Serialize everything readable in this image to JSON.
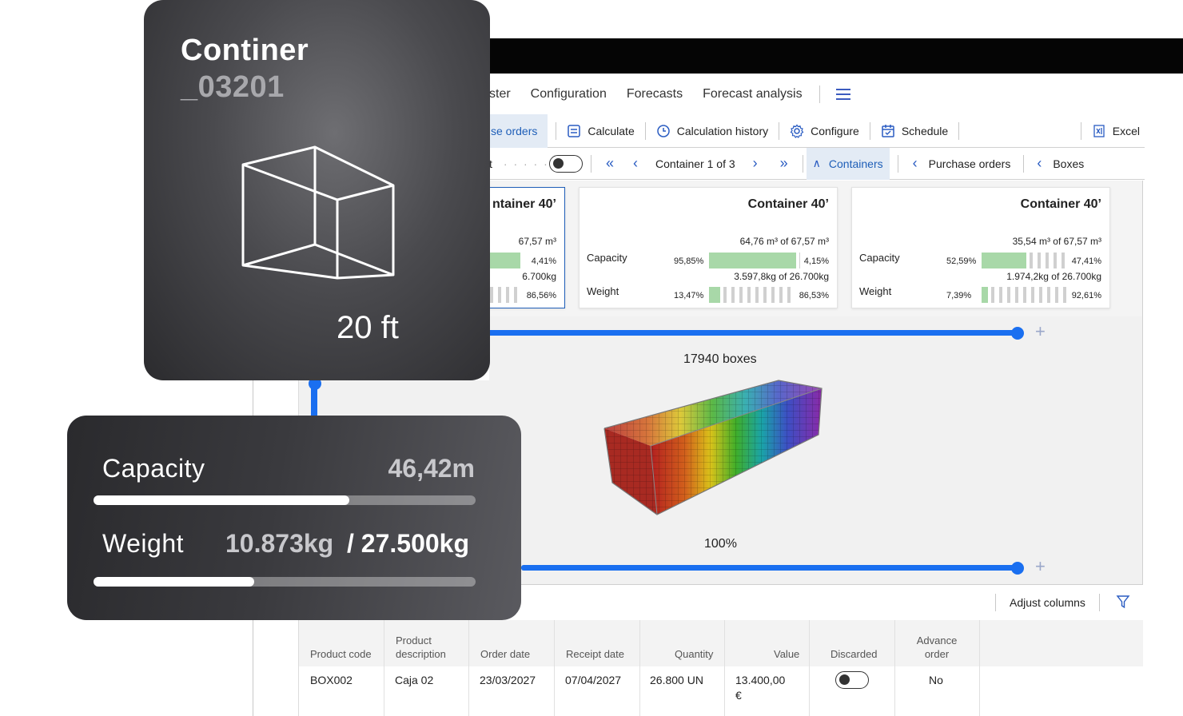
{
  "container_card": {
    "title": "Continer",
    "code": "_03201",
    "size": "20 ft"
  },
  "stats_card": {
    "capacity_label": "Capacity",
    "capacity_value": "46,42m",
    "capacity_fill": 0.67,
    "weight_label": "Weight",
    "weight_used": "10.873kg",
    "weight_total": "/ 27.500kg",
    "weight_fill": 0.42
  },
  "menu": {
    "items": [
      "ster",
      "Configuration",
      "Forecasts",
      "Forecast analysis"
    ]
  },
  "toolbar": {
    "purchase_orders": "se orders",
    "calculate": "Calculate",
    "calculation_history": "Calculation history",
    "configure": "Configure",
    "schedule": "Schedule",
    "excel": "Excel"
  },
  "nav": {
    "left_text": "t",
    "container_counter": "Container 1 of 3",
    "containers": "Containers",
    "purchase_orders": "Purchase orders",
    "boxes": "Boxes"
  },
  "cards": [
    {
      "title": "ntainer 40’",
      "capacity_value": "67,57 m³",
      "capacity_pct_right": "4,41%",
      "weight_value": "6.700kg",
      "weight_pct_right": "86,56%"
    },
    {
      "title": "Container 40’",
      "capacity_label": "Capacity",
      "capacity_value": "64,76 m³ of 67,57 m³",
      "capacity_pct_left": "95,85%",
      "capacity_pct_right": "4,15%",
      "capacity_fill": 0.9585,
      "weight_label": "Weight",
      "weight_value": "3.597,8kg of 26.700kg",
      "weight_pct_left": "13,47%",
      "weight_pct_right": "86,53%",
      "weight_fill": 0.1347
    },
    {
      "title": "Container 40’",
      "capacity_label": "Capacity",
      "capacity_value": "35,54 m³ of 67,57 m³",
      "capacity_pct_left": "52,59%",
      "capacity_pct_right": "47,41%",
      "capacity_fill": 0.5259,
      "weight_label": "Weight",
      "weight_value": "1.974,2kg of 26.700kg",
      "weight_pct_left": "7,39%",
      "weight_pct_right": "92,61%",
      "weight_fill": 0.0739
    }
  ],
  "viewer": {
    "boxes_label": "17940 boxes",
    "percent_label": "100%"
  },
  "table_tools": {
    "adjust_columns": "Adjust columns"
  },
  "table": {
    "headers": [
      "Product code",
      "Product description",
      "Order date",
      "Receipt date",
      "Quantity",
      "Value",
      "Discarded",
      "Advance order"
    ],
    "rows": [
      {
        "product_code": "BOX002",
        "description": "Caja 02",
        "order_date": "23/03/2027",
        "receipt_date": "07/04/2027",
        "quantity": "26.800 UN",
        "value": "13.400,00",
        "currency": "€",
        "advance_order": "No"
      }
    ]
  },
  "colors": {
    "accent_blue": "#1a6ff0",
    "link_blue": "#1f5fb8",
    "bar_green": "#a8d8a8"
  }
}
